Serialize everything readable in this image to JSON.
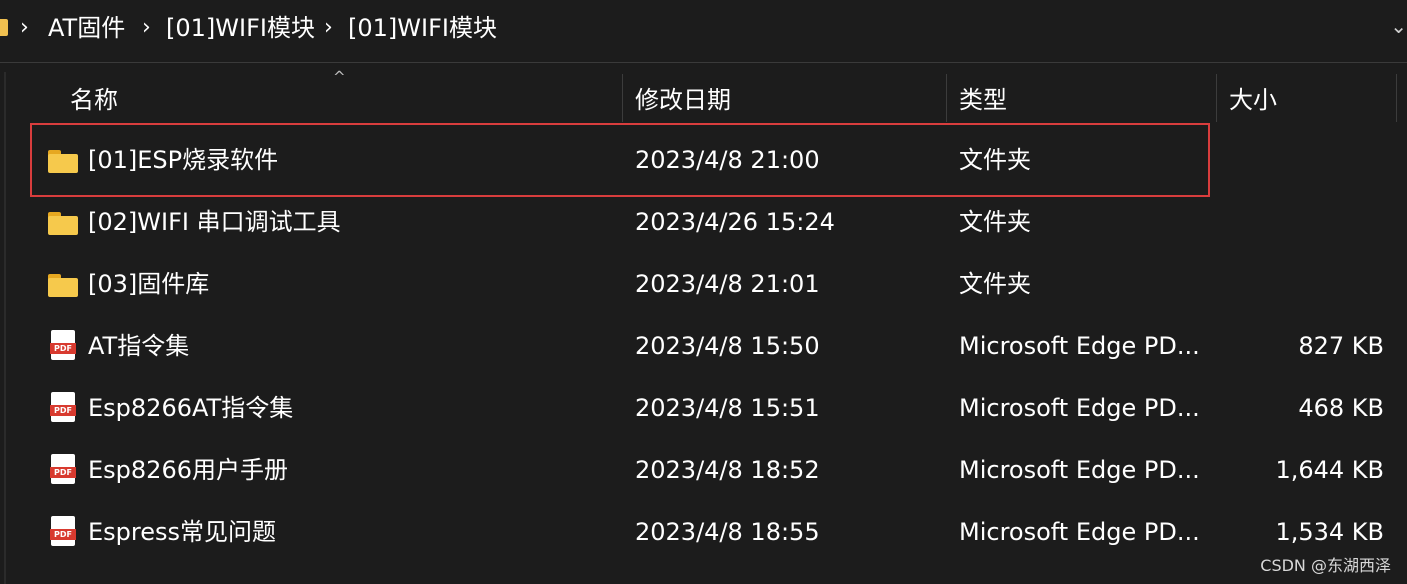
{
  "breadcrumb": [
    "AT固件",
    "[01]WIFI模块",
    "[01]WIFI模块"
  ],
  "columns": {
    "name": "名称",
    "date": "修改日期",
    "type": "类型",
    "size": "大小"
  },
  "files": [
    {
      "name": "[01]ESP烧录软件",
      "date": "2023/4/8 21:00",
      "type": "文件夹",
      "size": "",
      "icon": "folder-icon"
    },
    {
      "name": "[02]WIFI 串口调试工具",
      "date": "2023/4/26 15:24",
      "type": "文件夹",
      "size": "",
      "icon": "folder-icon"
    },
    {
      "name": "[03]固件库",
      "date": "2023/4/8 21:01",
      "type": "文件夹",
      "size": "",
      "icon": "folder-icon"
    },
    {
      "name": "AT指令集",
      "date": "2023/4/8 15:50",
      "type": "Microsoft Edge PD...",
      "size": "827 KB",
      "icon": "pdf-icon"
    },
    {
      "name": "Esp8266AT指令集",
      "date": "2023/4/8 15:51",
      "type": "Microsoft Edge PD...",
      "size": "468 KB",
      "icon": "pdf-icon"
    },
    {
      "name": "Esp8266用户手册",
      "date": "2023/4/8 18:52",
      "type": "Microsoft Edge PD...",
      "size": "1,644 KB",
      "icon": "pdf-icon"
    },
    {
      "name": "Espress常见问题",
      "date": "2023/4/8 18:55",
      "type": "Microsoft Edge PD...",
      "size": "1,534 KB",
      "icon": "pdf-icon"
    }
  ],
  "pdf_icon_text": "PDF",
  "watermark": "CSDN @东湖西泽",
  "colors": {
    "background": "#1c1c1c",
    "highlight_border": "#d93d3d",
    "folder": "#f6c94c",
    "pdf": "#d83a2f"
  }
}
